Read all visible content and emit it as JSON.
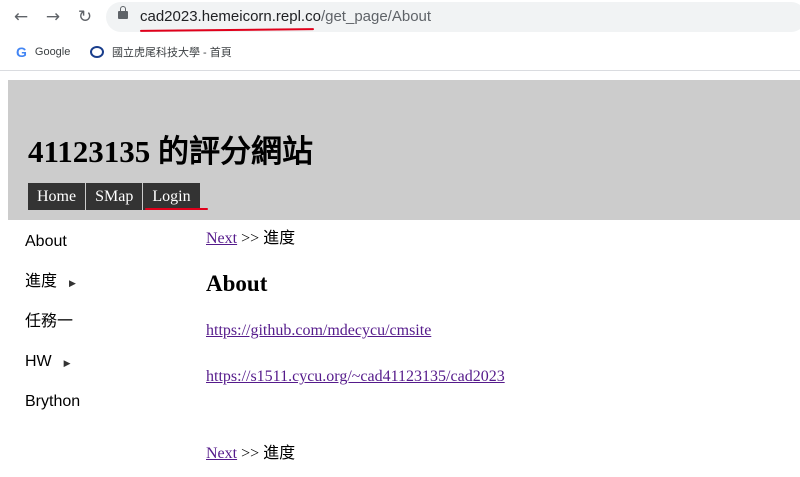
{
  "browser": {
    "url_host": "cad2023.hemeicorn.repl.co",
    "url_path": "/get_page/About",
    "bookmarks": [
      {
        "label": "Google",
        "icon": "google-icon"
      },
      {
        "label": "國立虎尾科技大學 - 首頁",
        "icon": "school-logo-icon"
      }
    ]
  },
  "site": {
    "title": "41123135 的評分網站",
    "menu": [
      "Home",
      "SMap",
      "Login"
    ]
  },
  "sidebar": {
    "items": [
      {
        "label": "About",
        "has_submenu": false
      },
      {
        "label": "進度",
        "has_submenu": true
      },
      {
        "label": "任務一",
        "has_submenu": false
      },
      {
        "label": "HW",
        "has_submenu": true
      },
      {
        "label": "Brython",
        "has_submenu": false
      }
    ]
  },
  "content": {
    "next_link": "Next",
    "separator": ">>",
    "next_target": "進度",
    "heading": "About",
    "links": [
      "https://github.com/mdecycu/cmsite",
      "https://s1511.cycu.org/~cad41123135/cad2023"
    ]
  },
  "colors": {
    "header_bg": "#cccccc",
    "menu_bg": "#333333",
    "link": "#551a8b",
    "annotation_red": "#e0001b"
  }
}
